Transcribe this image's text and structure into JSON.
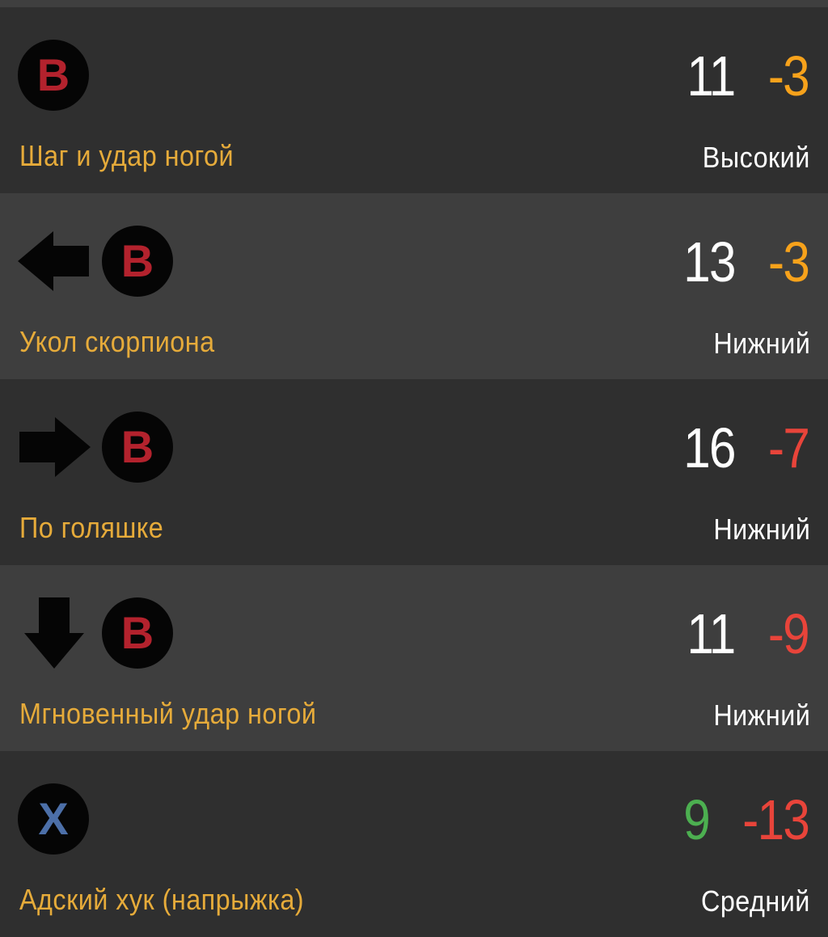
{
  "moves": [
    {
      "inputs": [
        {
          "type": "button",
          "label": "B"
        }
      ],
      "startup": "11",
      "advantage": "-3",
      "name": "Шаг и удар ногой",
      "hit_level": "Высокий"
    },
    {
      "inputs": [
        {
          "type": "arrow",
          "icon": "arrow-left-icon"
        },
        {
          "type": "button",
          "label": "B"
        }
      ],
      "startup": "13",
      "advantage": "-3",
      "name": "Укол скорпиона",
      "hit_level": "Нижний"
    },
    {
      "inputs": [
        {
          "type": "arrow",
          "icon": "arrow-right-icon"
        },
        {
          "type": "button",
          "label": "B"
        }
      ],
      "startup": "16",
      "advantage": "-7",
      "name": "По голяшке",
      "hit_level": "Нижний"
    },
    {
      "inputs": [
        {
          "type": "arrow",
          "icon": "arrow-down-icon"
        },
        {
          "type": "button",
          "label": "B"
        }
      ],
      "startup": "11",
      "advantage": "-9",
      "name": "Мгновенный удар ногой",
      "hit_level": "Нижний"
    },
    {
      "inputs": [
        {
          "type": "button",
          "label": "X"
        }
      ],
      "startup": "9",
      "advantage": "-13",
      "name": "Адский хук  (напрыжка)",
      "hit_level": "Средний"
    }
  ],
  "colors": {
    "row_dark": "#2f2f2f",
    "row_light": "#3e3e3e",
    "move_name": "#e6ab3a",
    "hit_level": "#ffffff",
    "button_b": "#b3222d",
    "button_x": "#4c6fa8",
    "advantage_orange": "#f7a21b",
    "advantage_red": "#e8443a",
    "startup_green": "#4caf50"
  }
}
